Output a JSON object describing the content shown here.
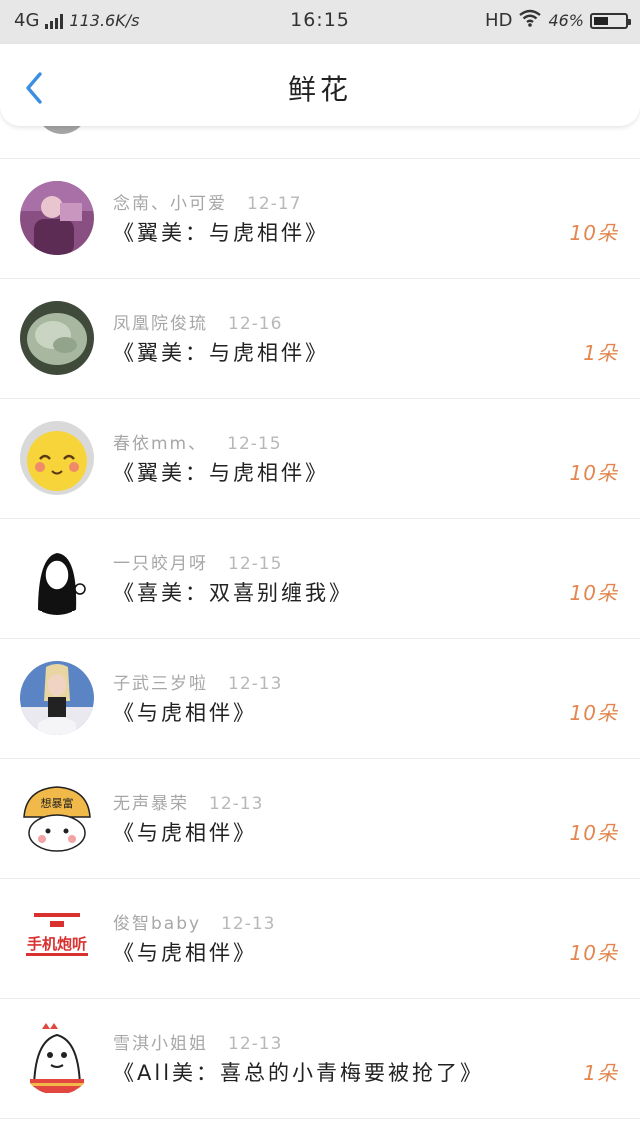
{
  "status_bar": {
    "network": "4G",
    "speed": "113.6K/s",
    "time": "16:15",
    "hd": "HD",
    "battery_text": "46%",
    "battery_level": 0.46
  },
  "header": {
    "title": "鲜花",
    "back_icon": "chevron-left-icon"
  },
  "colors": {
    "accent": "#3b8fe0",
    "count": "#e3874f",
    "meta": "#a7a7a7"
  },
  "records": [
    {
      "user": "念南、小可爱",
      "date": "12-17",
      "gift": "《翼美：与虎相伴》",
      "count": "10朵"
    },
    {
      "user": "凤凰院俊琉",
      "date": "12-16",
      "gift": "《翼美：与虎相伴》",
      "count": "1朵"
    },
    {
      "user": "春依mm、",
      "date": "12-15",
      "gift": "《翼美：与虎相伴》",
      "count": "10朵"
    },
    {
      "user": "一只皎月呀",
      "date": "12-15",
      "gift": "《喜美：双喜别缠我》",
      "count": "10朵"
    },
    {
      "user": "子武三岁啦",
      "date": "12-13",
      "gift": "《与虎相伴》",
      "count": "10朵"
    },
    {
      "user": "无声暴荣",
      "date": "12-13",
      "gift": "《与虎相伴》",
      "count": "10朵"
    },
    {
      "user": "俊智baby",
      "date": "12-13",
      "gift": "《与虎相伴》",
      "count": "10朵"
    },
    {
      "user": "雪淇小姐姐",
      "date": "12-13",
      "gift": "《All美：喜总的小青梅要被抢了》",
      "count": "1朵"
    }
  ],
  "avatar_texts": {
    "helmet": "想暴富",
    "logo": "手机炮听"
  }
}
